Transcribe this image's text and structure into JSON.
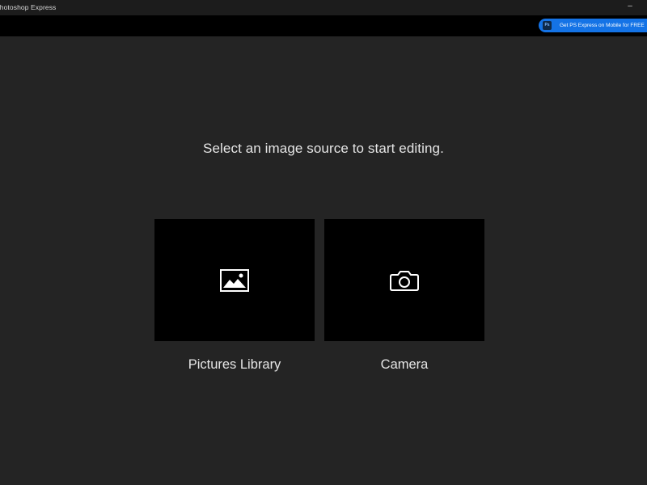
{
  "window": {
    "title": "Photoshop Express",
    "minimize_glyph": "–"
  },
  "appbar": {
    "promo": {
      "badge_text": "Ps",
      "label": "Get PS Express on Mobile for FREE",
      "color": "#1473e6"
    }
  },
  "main": {
    "prompt": "Select an image source to start editing.",
    "sources": [
      {
        "label": "Pictures Library",
        "icon": "picture-icon"
      },
      {
        "label": "Camera",
        "icon": "camera-icon"
      }
    ]
  }
}
